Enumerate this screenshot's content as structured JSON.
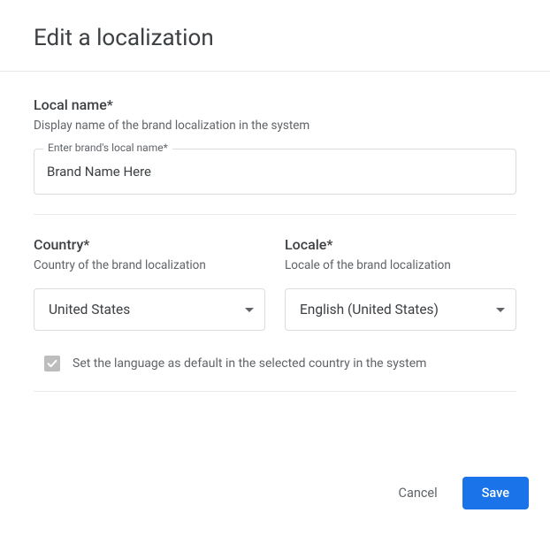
{
  "header": {
    "title": "Edit a localization"
  },
  "localName": {
    "label": "Local name*",
    "hint": "Display name of the brand localization in the system",
    "fieldLabel": "Enter brand's local name*",
    "value": "Brand Name Here"
  },
  "country": {
    "label": "Country*",
    "hint": "Country of the brand localization",
    "selected": "United States"
  },
  "locale": {
    "label": "Locale*",
    "hint": "Locale of the brand localization",
    "selected": "English (United States)"
  },
  "defaultCheckbox": {
    "label": "Set the language as default in the selected country in the system",
    "checked": true
  },
  "footer": {
    "cancel": "Cancel",
    "save": "Save"
  }
}
